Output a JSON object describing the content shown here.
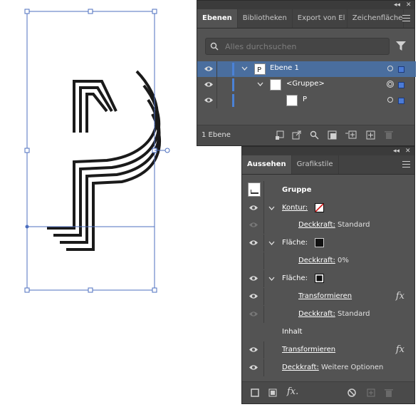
{
  "layers_panel": {
    "tabs": [
      {
        "label": "Ebenen",
        "active": true
      },
      {
        "label": "Bibliotheken",
        "active": false
      },
      {
        "label": "Export von El",
        "active": false
      },
      {
        "label": "Zeichenfläche",
        "active": false
      }
    ],
    "collapse_label": "◂◂",
    "close_label": "✕",
    "search_placeholder": "Alles durchsuchen",
    "rows": [
      {
        "label": "Ebene 1",
        "expanded": true
      },
      {
        "label": "<Gruppe>",
        "expanded": true
      },
      {
        "label": "P",
        "expanded": false
      }
    ],
    "footer_count": "1 Ebene"
  },
  "appearance_panel": {
    "tabs": [
      {
        "label": "Aussehen",
        "active": true
      },
      {
        "label": "Grafikstile",
        "active": false
      }
    ],
    "collapse_label": "◂◂",
    "close_label": "✕",
    "header": "Gruppe",
    "rows": [
      {
        "label": "Kontur:",
        "value": ""
      },
      {
        "label": "Deckkraft:",
        "value": "Standard"
      },
      {
        "label": "Fläche:",
        "value": ""
      },
      {
        "label": "Deckkraft:",
        "value": "0%"
      },
      {
        "label": "Fläche:",
        "value": ""
      },
      {
        "label": "Transformieren",
        "fx": "fx"
      },
      {
        "label": "Deckkraft:",
        "value": "Standard"
      },
      {
        "label": "Inhalt",
        "value": ""
      },
      {
        "label": "Transformieren",
        "fx": "fx"
      },
      {
        "label": "Deckkraft:",
        "value": "Weitere Optionen"
      }
    ],
    "footer_fx": "fx."
  },
  "colors": {
    "panel_bg": "#535353",
    "selection_blue": "#4b82d6",
    "highlight_row": "#4a6e9e",
    "bbox_blue": "#4c6fbf",
    "ink": "#1a1a1a"
  }
}
